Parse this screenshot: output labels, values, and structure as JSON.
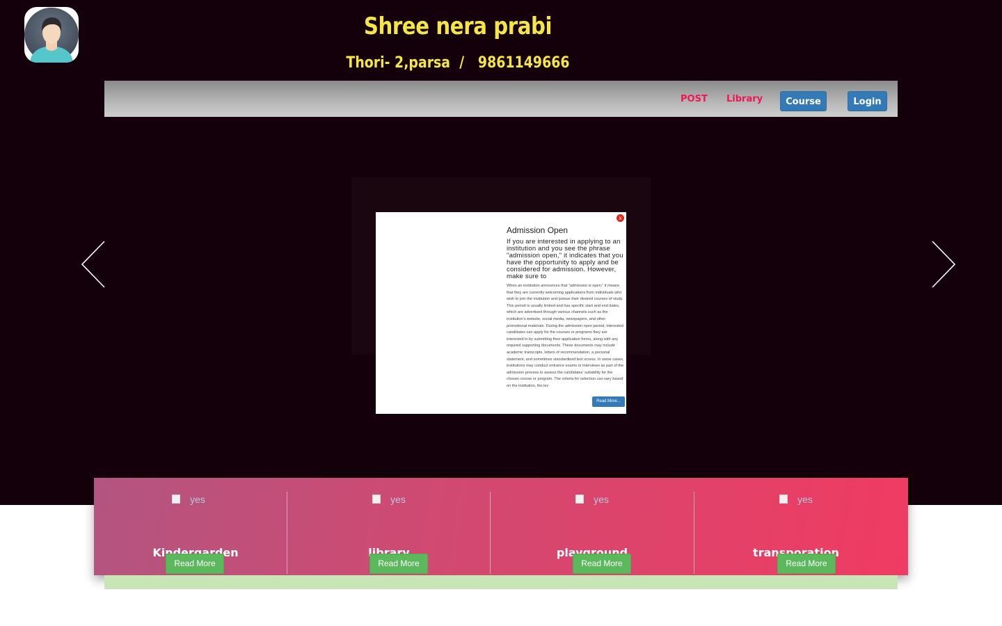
{
  "header": {
    "title": "Shree nera prabi",
    "subtitle": "Thori- 2,parsa  /   9861149666"
  },
  "nav": {
    "links": [
      "POST",
      "Library"
    ],
    "course_label": "Course",
    "login_label": "Login"
  },
  "modal": {
    "close_label": "x",
    "title": "Admission Open",
    "lead": "If you are interested in applying to an institution and you see the phrase \"admission open,\" it indicates that you have the opportunity to apply and be considered for admission. However, make sure to",
    "body": "When an institution announces that \"admission is open,\" it means that they are currently welcoming applications from individuals who wish to join the institution and pursue their desired courses of study. This period is usually limited and has specific start and end dates, which are advertised through various channels such as the institution's website, social media, newspapers, and other promotional materials. During the admission open period, interested candidates can apply for the courses or programs they are interested in by submitting their application forms, along with any required supporting documents. These documents may include academic transcripts, letters of recommendation, a personal statement, and sometimes standardized test scores. In some cases, institutions may conduct entrance exams or interviews as part of the admission process to assess the candidates' suitability for the chosen course or program. The criteria for selection can vary based on the institution, the lev",
    "read_more": "Read More..."
  },
  "features": [
    {
      "img_alt": "yes",
      "title": "Kindergarden",
      "button": "Read More"
    },
    {
      "img_alt": "yes",
      "title": "library",
      "button": "Read More"
    },
    {
      "img_alt": "yes",
      "title": "playground",
      "button": "Read More"
    },
    {
      "img_alt": "yes",
      "title": "transporation",
      "button": "Read More"
    }
  ],
  "icons": {
    "avatar": "user-avatar-icon",
    "prev": "chevron-left-icon",
    "next": "chevron-right-icon",
    "broken_image": "broken-image-icon"
  },
  "colors": {
    "hero_background": "#14000a",
    "title": "#f5e642",
    "nav_link": "#ee1752",
    "primary_button": "#337ab7",
    "success_button": "#5cb85c",
    "feature_gradient_start": "#b25580",
    "feature_gradient_end": "#f03b62"
  }
}
